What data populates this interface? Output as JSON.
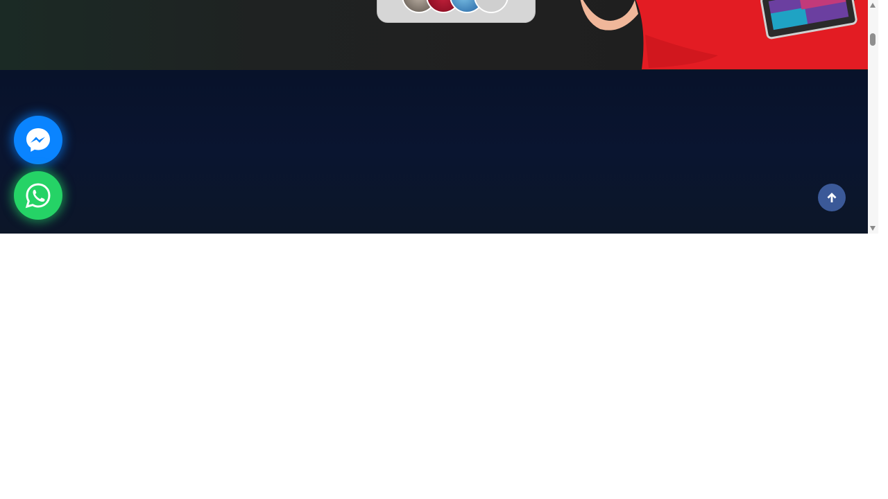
{
  "hero": {
    "avatars": [
      "avatar-1",
      "avatar-2",
      "avatar-3",
      "avatar-4"
    ],
    "colors": {
      "shirt": "#e31c23"
    }
  },
  "floating_buttons": {
    "messenger": {
      "icon": "messenger-icon",
      "color": "#0a84ff"
    },
    "whatsapp": {
      "icon": "whatsapp-icon",
      "color": "#25d366"
    }
  },
  "back_to_top": {
    "icon": "arrow-up-icon",
    "color": "#3b5998"
  },
  "section": {
    "background": "#08122a"
  }
}
